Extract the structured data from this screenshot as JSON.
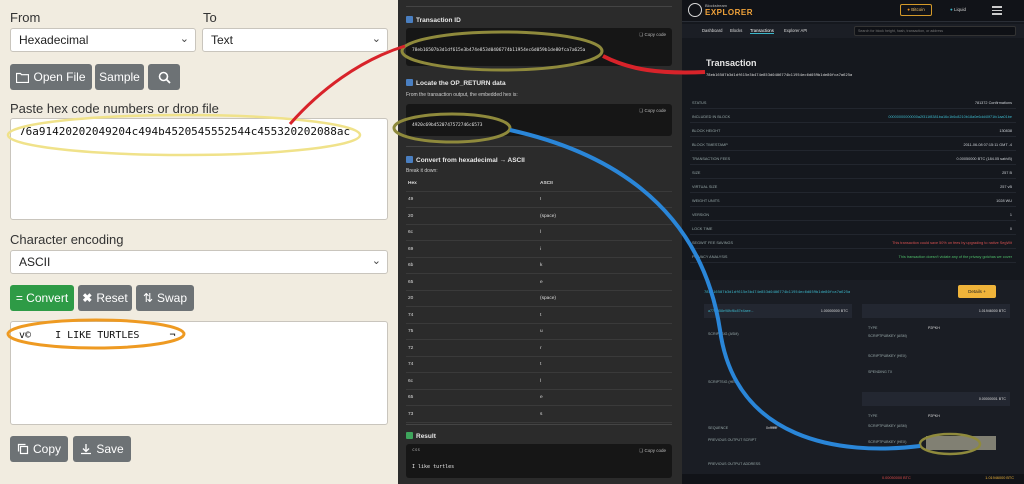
{
  "converter": {
    "from_label": "From",
    "to_label": "To",
    "from_value": "Hexadecimal",
    "to_value": "Text",
    "open_file_label": "Open File",
    "sample_label": "Sample",
    "input_label": "Paste hex code numbers or drop file",
    "input_value": "76a91420202049204c494b4520545552544c455320202088ac",
    "encoding_label": "Character encoding",
    "encoding_value": "ASCII",
    "convert_label": "= Convert",
    "reset_label": "Reset",
    "swap_label": "Swap",
    "output_value": "v©    I LIKE TURTLES     ¬",
    "copy_label": "Copy",
    "save_label": "Save"
  },
  "tutorial": {
    "txid_heading": "Transaction ID",
    "copy_code": "Copy code",
    "txid_value": "78eb16507b3d1df615e3b474e853d0406774b11954ec6d059b1de80fca7a625a",
    "opreturn_heading": "Locate the OP_RETURN data",
    "opreturn_desc": "From the transaction output, the embedded hex is:",
    "opreturn_value": "4920c69b4520747572746c6573",
    "convert_heading": "Convert from hexadecimal → ASCII",
    "breakdown": "Break it down:",
    "col_hex": "Hex",
    "col_ascii": "ASCII",
    "rows": [
      {
        "hex": "49",
        "ascii": "I"
      },
      {
        "hex": "20",
        "ascii": "(space)"
      },
      {
        "hex": "6c",
        "ascii": "l"
      },
      {
        "hex": "69",
        "ascii": "i"
      },
      {
        "hex": "6b",
        "ascii": "k"
      },
      {
        "hex": "65",
        "ascii": "e"
      },
      {
        "hex": "20",
        "ascii": "(space)"
      },
      {
        "hex": "74",
        "ascii": "t"
      },
      {
        "hex": "75",
        "ascii": "u"
      },
      {
        "hex": "72",
        "ascii": "r"
      },
      {
        "hex": "74",
        "ascii": "t"
      },
      {
        "hex": "6c",
        "ascii": "l"
      },
      {
        "hex": "65",
        "ascii": "e"
      },
      {
        "hex": "73",
        "ascii": "s"
      }
    ],
    "result_heading": "Result",
    "result_lang": "css",
    "result_value": "I like turtles"
  },
  "explorer": {
    "brand_top": "Blockstream",
    "brand": "EXPLORER",
    "net_bitcoin": "Bitcoin",
    "net_liquid": "Liquid",
    "nav": [
      "Dashboard",
      "Blocks",
      "Transactions",
      "Explorer API"
    ],
    "search_placeholder": "Search for block height, hash, transaction, or address",
    "title": "Transaction",
    "txid": "78eb16507b3d1df615e3b474e853d0406774b11954ec6d059b1de80fca7a625a",
    "rows": [
      {
        "k": "STATUS",
        "v": "781372 Confirmations"
      },
      {
        "k": "INCLUDED IN BLOCK",
        "v": "00000000000000a2f311f8381ba16c1b6c8210b18a0e6dd40f71fc1aa01be"
      },
      {
        "k": "BLOCK HEIGHT",
        "v": "130838"
      },
      {
        "k": "BLOCK TIMESTAMP",
        "v": "2011-06-08 07:15:11 GMT -4"
      },
      {
        "k": "TRANSACTION FEES",
        "v": "0.00050000 BTC (184.05 sat/vB)"
      },
      {
        "k": "SIZE",
        "v": "257 B"
      },
      {
        "k": "VIRTUAL SIZE",
        "v": "257 vB"
      },
      {
        "k": "WEIGHT UNITS",
        "v": "1028 WU"
      },
      {
        "k": "VERSION",
        "v": "1"
      },
      {
        "k": "LOCK TIME",
        "v": "0"
      },
      {
        "k": "SEGWIT FEE SAVINGS",
        "v": "This transaction could save 50% on fees by upgrading to native SegWit"
      },
      {
        "k": "PRIVACY ANALYSIS",
        "v": "This transaction doesn't violate any of the privacy gotchas we cover"
      }
    ],
    "details_label": "Details +",
    "input_txid": "a77f5d58e98fcf6c87e4aee...",
    "input_amount": "1.00000000 BTC",
    "output_1": "1.01946000 BTC",
    "output_2": "0.00000001 BTC",
    "type_label": "TYPE",
    "type_value": "P2PKH",
    "scriptpubkey_label": "SCRIPTPUBKEY (ASM)",
    "scriptpubkey_hex_label": "SCRIPTPUBKEY (HEX)",
    "spending_label": "SPENDING TX",
    "sequence_label": "SEQUENCE",
    "sequence_value": "0xffffffff",
    "prev_script_label": "PREVIOUS OUTPUT SCRIPT",
    "prev_addr_label": "PREVIOUS OUTPUT ADDRESS",
    "footer_in": "1.01946000 BTC",
    "footer_fee": "0.00050000 BTC"
  },
  "colors": {
    "red_arrow": "#d8232a",
    "blue_arrow": "#2a86d8",
    "yellow_circle": "#f0e28a",
    "olive_circle": "#8f8a3c",
    "orange_circle": "#ee9a22",
    "explorer_accent": "#3bb6c9",
    "explorer_bg": "#15181e"
  }
}
